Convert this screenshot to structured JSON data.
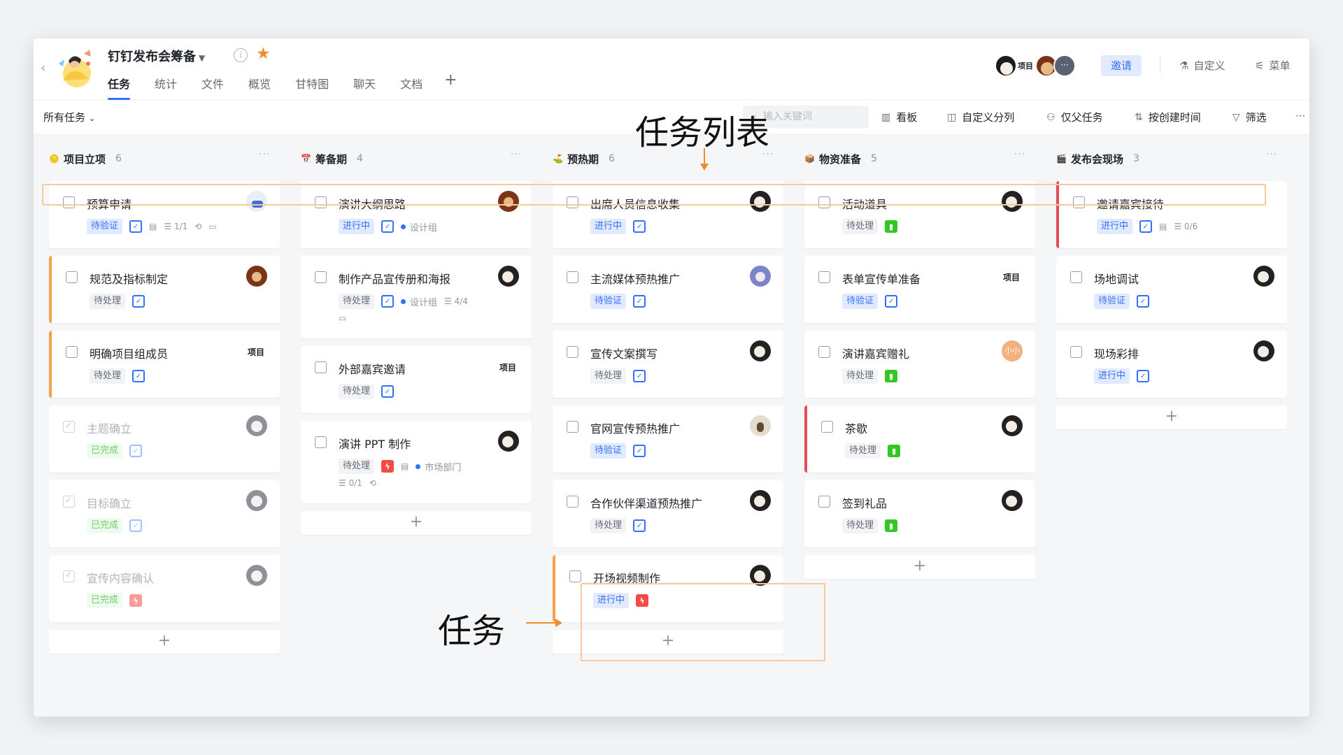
{
  "project": {
    "title": "钉钉发布会筹备",
    "star": true
  },
  "tabs": [
    "任务",
    "统计",
    "文件",
    "概览",
    "甘特图",
    "聊天",
    "文档"
  ],
  "header": {
    "member_tag": "项目",
    "invite": "邀请",
    "customize": "自定义",
    "menu": "菜单"
  },
  "toolbar": {
    "filter_scope": "所有任务",
    "search_placeholder": "输入关键词",
    "kanban": "看板",
    "custom_group": "自定义分列",
    "parent_only": "仅父任务",
    "sort": "按创建时间",
    "filter": "筛选"
  },
  "annotations": {
    "task_list": "任务列表",
    "task": "任务"
  },
  "colors": {
    "accent": "#3370ff",
    "orange": "#f08c2a",
    "annotation_box": "#f7c99b"
  },
  "columns": [
    {
      "name": "项目立项",
      "count": "6",
      "icon": "coin-icon",
      "tasks": [
        {
          "title": "预算申请",
          "status": "待验证",
          "avatar": "blueish",
          "extras": [
            "1/1"
          ]
        },
        {
          "title": "规范及指标制定",
          "status": "待处理",
          "avatar": "brown",
          "accent": "orange"
        },
        {
          "title": "明确项目组成员",
          "status": "待处理",
          "tag": "项目",
          "accent": "orange"
        },
        {
          "title": "主题确立",
          "status": "已完成",
          "avatar": "lgrey",
          "done": true
        },
        {
          "title": "目标确立",
          "status": "已完成",
          "avatar": "lgrey",
          "done": true
        },
        {
          "title": "宣传内容确认",
          "status": "已完成",
          "avatar": "lgrey",
          "done": true
        }
      ]
    },
    {
      "name": "筹备期",
      "count": "4",
      "icon": "calendar-icon",
      "tasks": [
        {
          "title": "演讲大纲思路",
          "status": "进行中",
          "avatar": "brown",
          "group": "设计组"
        },
        {
          "title": "制作产品宣传册和海报",
          "status": "待处理",
          "avatar": "dark",
          "group": "设计组",
          "subtasks": "4/4"
        },
        {
          "title": "外部嘉宾邀请",
          "status": "待处理",
          "tag": "项目"
        },
        {
          "title": "演讲 PPT 制作",
          "status": "待处理",
          "avatar": "dark",
          "group": "市场部门",
          "subtasks": "0/1"
        }
      ]
    },
    {
      "name": "预热期",
      "count": "6",
      "icon": "golf-icon",
      "tasks": [
        {
          "title": "出席人员信息收集",
          "status": "进行中",
          "avatar": "dark"
        },
        {
          "title": "主流媒体预热推广",
          "status": "待验证",
          "avatar": "purple"
        },
        {
          "title": "宣传文案撰写",
          "status": "待处理",
          "avatar": "dark"
        },
        {
          "title": "官网宣传预热推广",
          "status": "待验证",
          "avatar": "beige"
        },
        {
          "title": "合作伙伴渠道预热推广",
          "status": "待处理",
          "avatar": "dark"
        },
        {
          "title": "开场视频制作",
          "status": "进行中",
          "avatar": "dark",
          "accent": "orange"
        }
      ]
    },
    {
      "name": "物资准备",
      "count": "5",
      "icon": "box-icon",
      "tasks": [
        {
          "title": "活动道具",
          "status": "待处理",
          "avatar": "dark"
        },
        {
          "title": "表单宣传单准备",
          "status": "待验证",
          "tag": "项目"
        },
        {
          "title": "演讲嘉宾赠礼",
          "status": "待处理",
          "avatar_text": "小小"
        },
        {
          "title": "茶歇",
          "status": "待处理",
          "avatar": "dark",
          "accent": "red"
        },
        {
          "title": "签到礼品",
          "status": "待处理",
          "avatar": "dark"
        }
      ]
    },
    {
      "name": "发布会现场",
      "count": "3",
      "icon": "clapper-icon",
      "tasks": [
        {
          "title": "邀请嘉宾接待",
          "status": "进行中",
          "accent": "red",
          "subtasks": "0/6"
        },
        {
          "title": "场地调试",
          "status": "待验证",
          "avatar": "dark"
        },
        {
          "title": "现场彩排",
          "status": "进行中",
          "avatar": "dark"
        }
      ]
    }
  ]
}
